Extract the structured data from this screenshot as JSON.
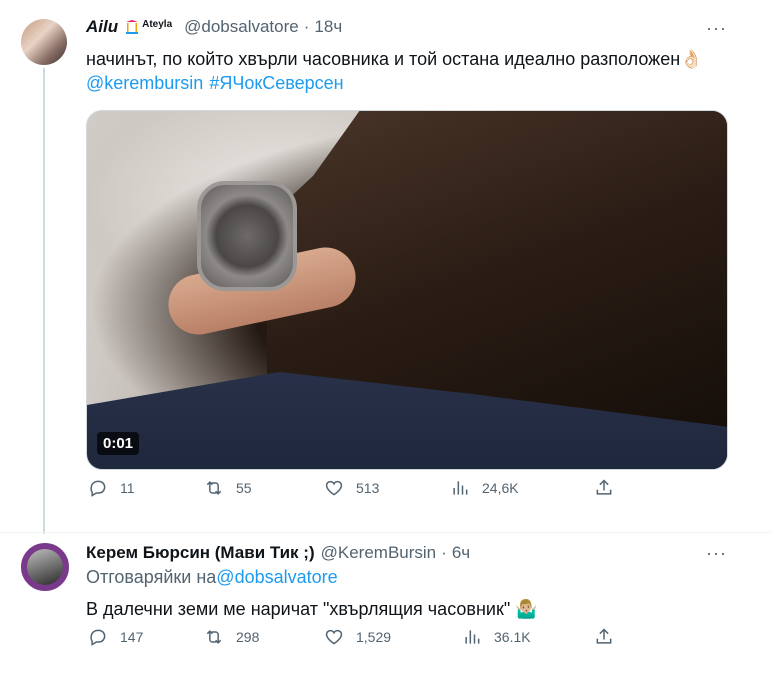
{
  "tweet1": {
    "author_name": "Ailu",
    "badge_text": "Ateyla",
    "handle": "@dobsalvatore",
    "separator": "·",
    "time": "18ч",
    "text": "начинът, по който хвърли часовника и той остана идеално разположен👌🏻",
    "mention": "@kerembursin",
    "hashtag": "#ЯЧокСеверсен",
    "media_duration": "0:01",
    "stats": {
      "replies": "11",
      "retweets": "55",
      "likes": "513",
      "views": "24,6K"
    }
  },
  "tweet2": {
    "author_name": "Керем Бюрсин (Мави Тик ;)",
    "handle": "@KeremBursin",
    "separator": "·",
    "time": "6ч",
    "reply_prefix": "Отговаряйки на",
    "reply_to": "@dobsalvatore",
    "text": "В далечни земи ме наричат \"хвърлящия часовник\" 🤷🏼‍♂️",
    "stats": {
      "replies": "147",
      "retweets": "298",
      "likes": "1,529",
      "views": "36.1K"
    }
  },
  "icons": [
    "more-icon",
    "reply-icon",
    "retweet-icon",
    "like-icon",
    "views-icon",
    "share-icon"
  ],
  "colors": {
    "link": "#1d9bf0",
    "secondary_text": "#536471",
    "thread_line": "#cfd9de",
    "avatar_ring": "#7a3a8c"
  }
}
